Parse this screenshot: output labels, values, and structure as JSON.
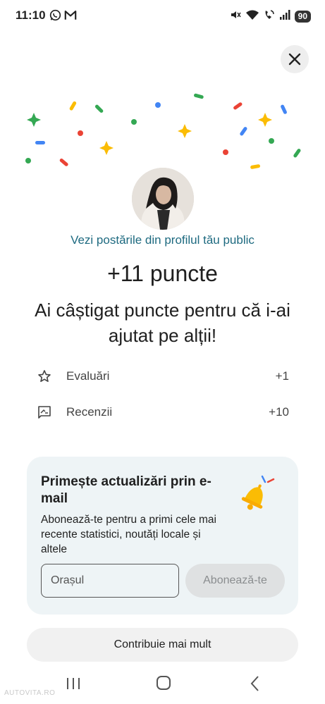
{
  "status_bar": {
    "time": "11:10",
    "battery": "90",
    "left_icons": [
      "whatsapp-icon",
      "gmail-icon"
    ],
    "right_icons": [
      "mute-icon",
      "wifi-icon",
      "wifi-call-icon",
      "signal-icon",
      "battery-icon"
    ]
  },
  "profile": {
    "link_text": "Vezi postările din profilul tău public"
  },
  "points": {
    "title": "+11 puncte",
    "subtitle": "Ai câștigat puncte pentru că i-ai ajutat pe alții!"
  },
  "contributions": [
    {
      "icon": "star-icon",
      "label": "Evaluări",
      "value": "+1"
    },
    {
      "icon": "review-icon",
      "label": "Recenzii",
      "value": "+10"
    }
  ],
  "email_card": {
    "title": "Primește actualizări prin e-mail",
    "body": "Abonează-te pentru a primi cele mai recente statistici, noutăți locale și altele",
    "input_placeholder": "Orașul",
    "subscribe_label": "Abonează-te",
    "icon": "bell-icon"
  },
  "contribute_button": "Contribuie mai mult",
  "watermark": "AUTOVITA.RO",
  "colors": {
    "link": "#1e6a80",
    "card_bg": "#eef4f6",
    "confetti": [
      "#4285f4",
      "#ea4335",
      "#fbbc04",
      "#34a853"
    ]
  }
}
